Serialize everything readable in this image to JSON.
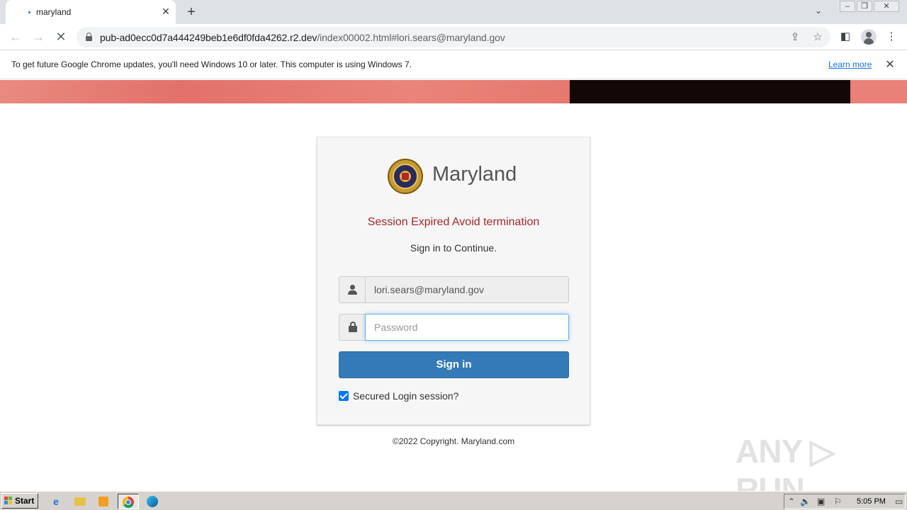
{
  "browser": {
    "tab_title": "maryland",
    "url_host": "pub-ad0ecc0d7a444249beb1e6df0fda4262.r2.dev",
    "url_rest": "/index00002.html#lori.sears@maryland.gov",
    "infobar_message": "To get future Google Chrome updates, you'll need Windows 10 or later. This computer is using Windows 7.",
    "infobar_link": "Learn more"
  },
  "page": {
    "brand": "Maryland",
    "session_message": "Session Expired Avoid termination",
    "subtitle": "Sign in to Continue.",
    "email_value": "lori.sears@maryland.gov",
    "password_placeholder": "Password",
    "signin_label": "Sign in",
    "secured_label": "Secured Login session?",
    "secured_checked": true,
    "copyright": "©2022 Copyright. Maryland.com",
    "watermark": "ANY RUN"
  },
  "colors": {
    "session_red": "#a3282a",
    "button_blue": "#337ab7",
    "link_blue": "#1a73e8"
  },
  "taskbar": {
    "start_label": "Start",
    "clock": "5:05 PM"
  }
}
